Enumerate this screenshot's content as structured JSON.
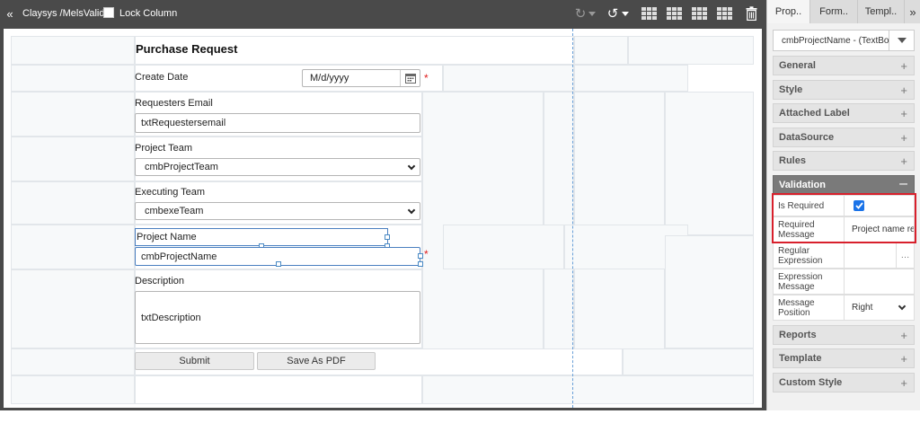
{
  "toolbar": {
    "breadcrumb": "Claysys /MelsValid",
    "lock_column_label": "Lock Column"
  },
  "form": {
    "title": "Purchase Request",
    "create_date_label": "Create Date",
    "create_date_placeholder": "M/d/yyyy",
    "requesters_email_label": "Requesters Email",
    "requesters_email_value": "txtRequestersemail",
    "project_team_label": "Project Team",
    "project_team_value": "cmbProjectTeam",
    "executing_team_label": "Executing Team",
    "executing_team_value": "cmbexeTeam",
    "project_name_label": "Project Name",
    "project_name_value": "cmbProjectName",
    "description_label": "Description",
    "description_value": "txtDescription",
    "submit_label": "Submit",
    "save_pdf_label": "Save As PDF",
    "required_mark": "*"
  },
  "panel": {
    "tabs": [
      "Prop..",
      "Form..",
      "Templ.."
    ],
    "selected_control": "cmbProjectName - (TextBox)",
    "sections": {
      "general": "General",
      "style": "Style",
      "attached_label": "Attached Label",
      "datasource": "DataSource",
      "rules": "Rules",
      "validation": "Validation",
      "reports": "Reports",
      "template": "Template",
      "custom_style": "Custom Style"
    },
    "validation": {
      "is_required_label": "Is Required",
      "is_required_checked": true,
      "required_message_label": "Required Message",
      "required_message_value": "Project name re",
      "regular_expression_label": "Regular Expression",
      "regular_expression_value": "",
      "expression_message_label": "Expression Message",
      "expression_message_value": "",
      "message_position_label": "Message Position",
      "message_position_value": "Right"
    }
  },
  "colors": {
    "toolbar_bg": "#4a4a4a",
    "highlight_border": "#d8202c",
    "checkbox_blue": "#1a73e8",
    "required_star": "#e02020"
  }
}
